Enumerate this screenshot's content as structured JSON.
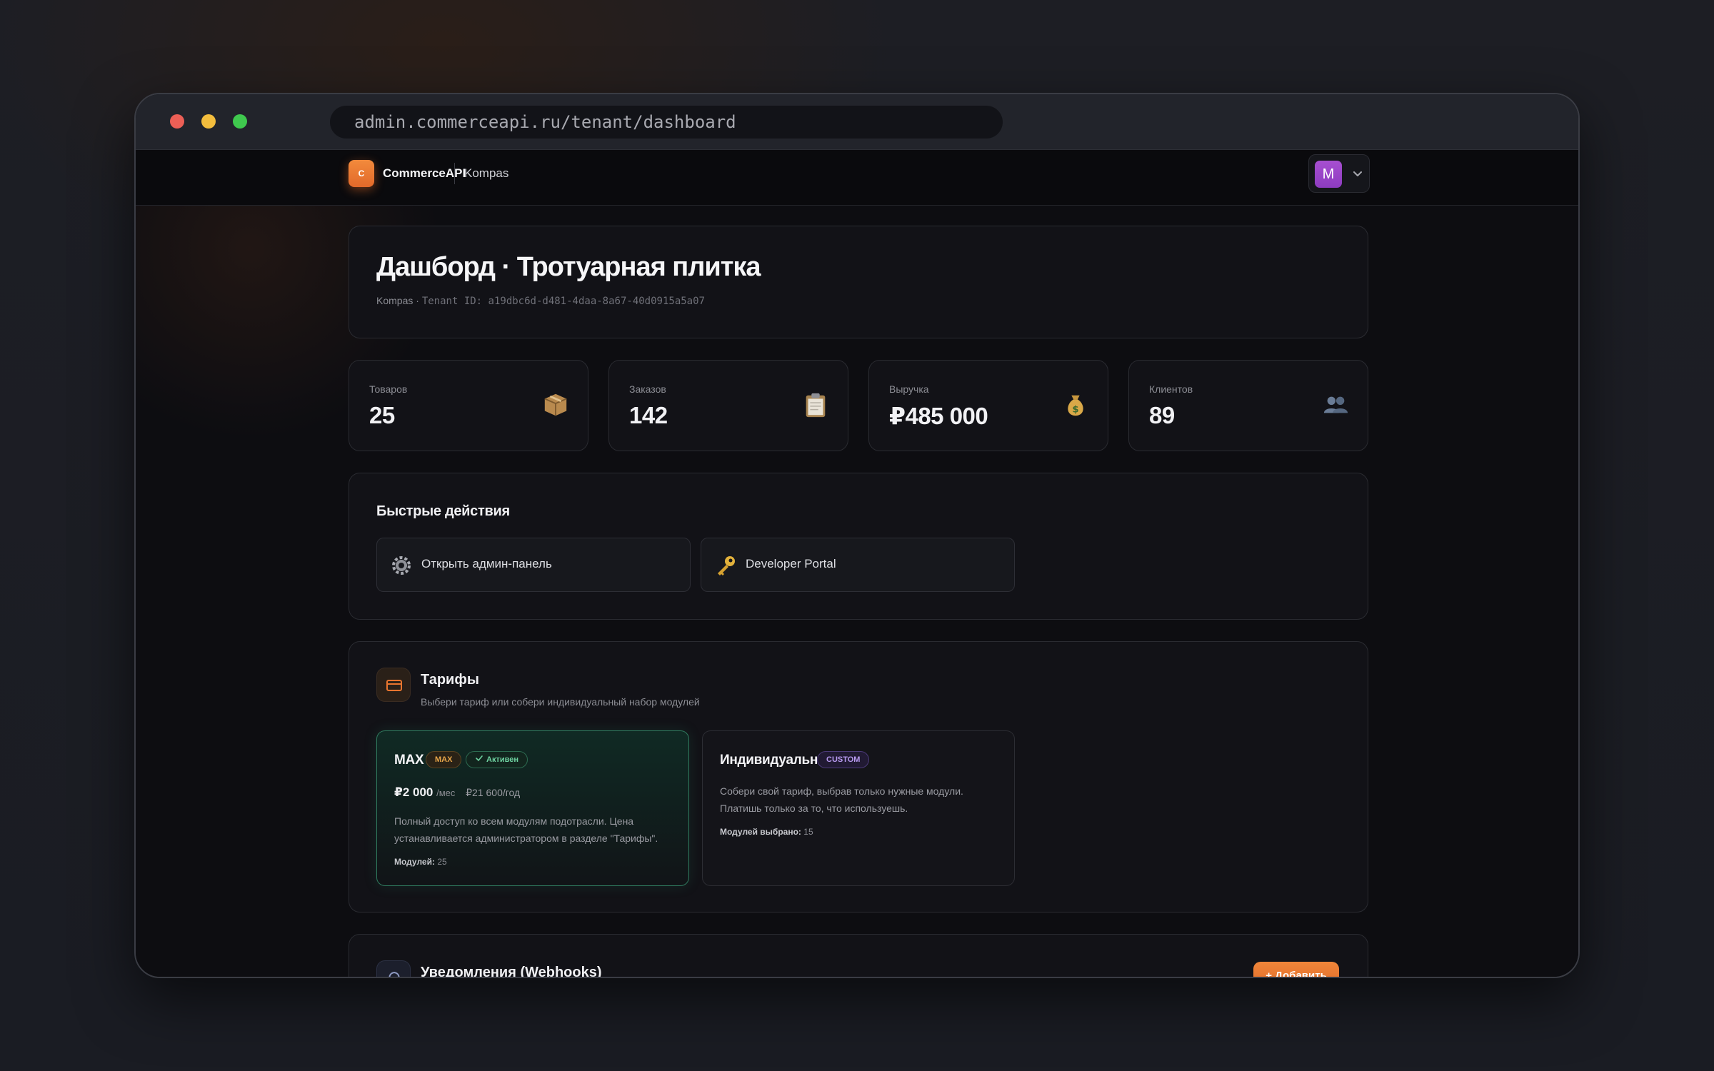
{
  "browser": {
    "url": "admin.commerceapi.ru/tenant/dashboard"
  },
  "appbar": {
    "logo_letter": "C",
    "brand": "CommerceAPI",
    "tenant": "Kompas",
    "avatar_letter": "M"
  },
  "hero": {
    "title": "Дашборд · Тротуарная плитка",
    "tenant": "Kompas",
    "separator": "·",
    "tenant_id": "Tenant ID: a19dbc6d-d481-4daa-8a67-40d0915a5a07"
  },
  "stats": [
    {
      "label": "Товаров",
      "value": "25",
      "icon": "package-icon"
    },
    {
      "label": "Заказов",
      "value": "142",
      "icon": "clipboard-icon"
    },
    {
      "label": "Выручка",
      "value": "₽485 000",
      "icon": "money-bag-icon"
    },
    {
      "label": "Клиентов",
      "value": "89",
      "icon": "users-icon"
    }
  ],
  "quick_actions": {
    "title": "Быстрые действия",
    "items": [
      {
        "label": "Открыть админ-панель",
        "icon": "gear-icon"
      },
      {
        "label": "Developer Portal",
        "icon": "key-icon"
      }
    ]
  },
  "tariffs": {
    "title": "Тарифы",
    "subtitle": "Выбери тариф или собери индивидуальный набор модулей",
    "plans": [
      {
        "name": "MAX",
        "badge": "MAX",
        "status": "Активен",
        "price": "₽2 000",
        "period": "/мес",
        "yearly": "₽21 600/год",
        "description": "Полный доступ ко всем модулям подотрасли. Цена устанавливается администратором в разделе \"Тарифы\".",
        "modules_label": "Модулей:",
        "modules_value": "25"
      },
      {
        "name": "Индивидуальный",
        "badge": "CUSTOM",
        "description": "Собери свой тариф, выбрав только нужные модули. Платишь только за то, что используешь.",
        "modules_label": "Модулей выбрано:",
        "modules_value": "15"
      }
    ]
  },
  "webhooks": {
    "title": "Уведомления (Webhooks)",
    "add_label": "Добавить",
    "add_plus": "+"
  },
  "colors": {
    "accent": "#e8752f",
    "active_green": "#2f7a5e",
    "background": "#0d0d11"
  }
}
